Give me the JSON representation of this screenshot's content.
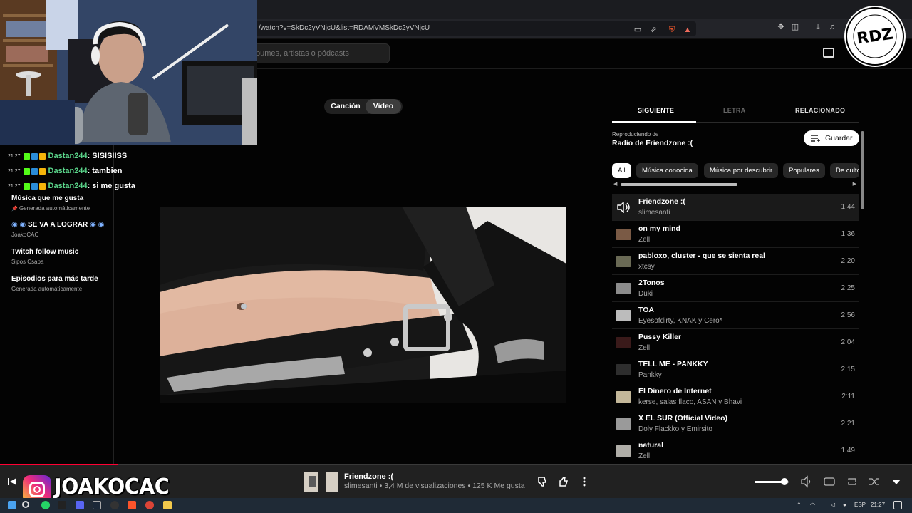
{
  "browser": {
    "url": "/watch?v=SkDc2yVNjcU&list=RDAMVMSkDc2yVNjcU"
  },
  "search": {
    "placeholder": "bumes, artistas o pódcasts"
  },
  "sidebar": {
    "playlists": [
      {
        "title": "Música que me gusta",
        "subtitle": "Generada automáticamente"
      },
      {
        "title": "SE VA A LOGRAR",
        "subtitle": "JoakoCAC"
      },
      {
        "title": "Twitch follow music",
        "subtitle": "Sipos Csaba"
      },
      {
        "title": "Episodios para más tarde",
        "subtitle": "Generada automáticamente"
      }
    ]
  },
  "chat": [
    {
      "time": "21:27",
      "user": "Dastan244",
      "message": ": SISISIISS"
    },
    {
      "time": "21:27",
      "user": "Dastan244",
      "message": ": tambien"
    },
    {
      "time": "21:27",
      "user": "Dastan244",
      "message": ": si me gusta"
    }
  ],
  "toggle": {
    "song": "Canción",
    "video": "Video",
    "selected": "video"
  },
  "right_panel": {
    "tabs": [
      "SIGUIENTE",
      "LETRA",
      "RELACIONADO"
    ],
    "playing_from_label": "Reproduciendo de",
    "radio_name": "Radio de Friendzone :(",
    "save_label": "Guardar",
    "chips": [
      "All",
      "Música conocida",
      "Música por descubrir",
      "Populares",
      "De culto"
    ],
    "queue": [
      {
        "title": "Friendzone :(",
        "artist": "slimesanti",
        "duration": "1:44",
        "playing": true
      },
      {
        "title": "on my mind",
        "artist": "Zell",
        "duration": "1:36"
      },
      {
        "title": "pabloxo, cluster - que se sienta real",
        "artist": "xtcsy",
        "duration": "2:20"
      },
      {
        "title": "2Tonos",
        "artist": "Duki",
        "duration": "2:25"
      },
      {
        "title": "TOA",
        "artist": "Eyesofdirty, KNAK y Cero*",
        "duration": "2:56"
      },
      {
        "title": "Pussy Killer",
        "artist": "Zell",
        "duration": "2:04"
      },
      {
        "title": "TELL ME - PANKKY",
        "artist": "Pankky",
        "duration": "2:15"
      },
      {
        "title": "El Dinero de Internet",
        "artist": "kerse, salas flaco, ASAN y Bhavi",
        "duration": "2:11"
      },
      {
        "title": "X EL SUR (Official Video)",
        "artist": "Doly Flackko y Emirsito",
        "duration": "2:21"
      },
      {
        "title": "natural",
        "artist": "Zell",
        "duration": "1:49"
      }
    ]
  },
  "player": {
    "title": "Friendzone :(",
    "meta": "slimesanti • 3,4 M de visualizaciones • 125 K Me gusta",
    "progress": 0.13,
    "volume": 0.85
  },
  "overlay": {
    "instagram_handle": "JOAKOCAC",
    "seal_text": "RDZ"
  },
  "taskbar": {
    "language": "ESP",
    "time": "21:27"
  }
}
